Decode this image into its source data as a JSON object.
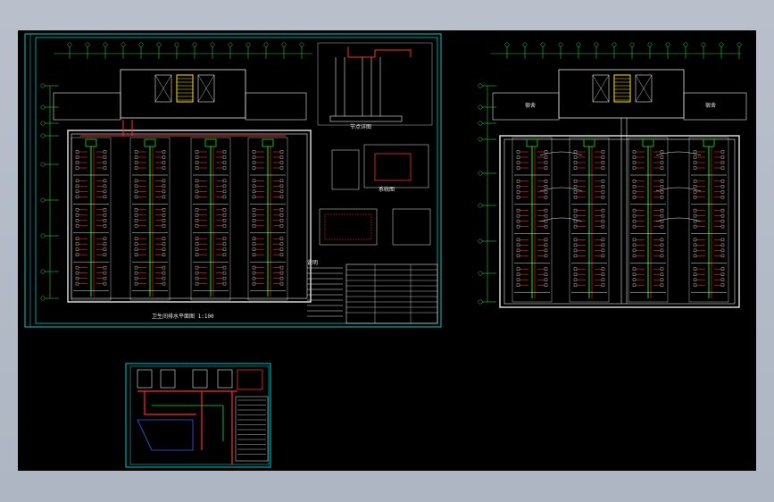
{
  "drawing": {
    "sheet1": {
      "plan_title": "卫生间排水平面图 1:100",
      "detail_section_label": "节点详图",
      "schematic_label": "系统图",
      "notes_title": "说明"
    },
    "sheet2": {
      "room_label_left": "宿舍",
      "room_label_right": "宿舍"
    },
    "sheet3": {}
  },
  "colors": {
    "background": "#000000",
    "frame": "#00c8c8",
    "lines": "#e6e6e6",
    "pipe_red": "#ff2a2a",
    "pipe_green": "#18e018",
    "stair_yellow": "#ffe600",
    "grid_green": "#22cc44",
    "blue": "#3a5cff"
  }
}
